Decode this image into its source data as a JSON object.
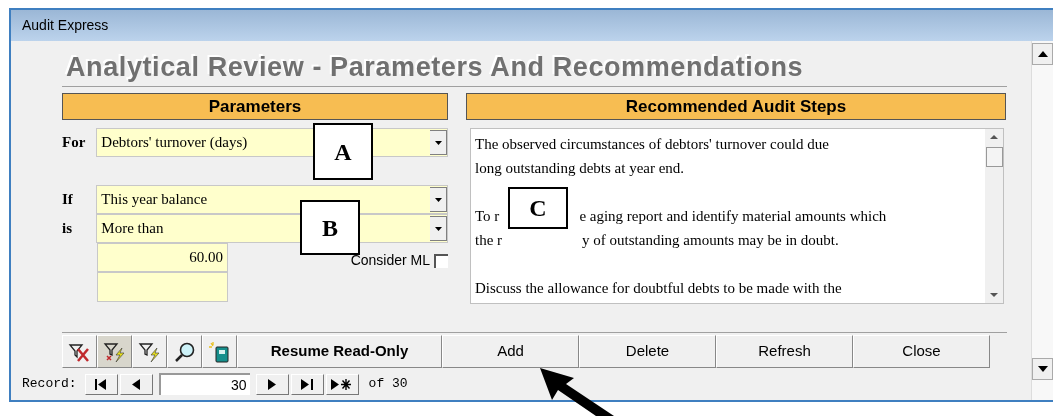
{
  "window": {
    "title": "Audit Express"
  },
  "heading": "Analytical Review - Parameters And Recommendations",
  "parameters": {
    "header": "Parameters",
    "fields": [
      {
        "label": "For",
        "value": "Debtors' turnover (days)"
      },
      {
        "label": "If",
        "value": "This year balance"
      },
      {
        "label": "is",
        "value": "More than"
      }
    ],
    "amount": "60.00",
    "consider_ml": {
      "label": "Consider ML",
      "checked": false
    }
  },
  "recommended": {
    "header": "Recommended Audit Steps",
    "paragraphs": [
      [
        "The observed circumstances of debtors' turnover could due",
        "long outstanding debts at year end."
      ],
      [
        [
          "To r",
          "e aging report and identify material amounts which"
        ],
        [
          "the r",
          "y of outstanding amounts may be in doubt."
        ]
      ],
      [
        "Discuss the allowance for doubtful debts to be made with the"
      ]
    ]
  },
  "buttons": [
    {
      "label": "Resume Read-Only",
      "kind": "bold"
    },
    {
      "label": "Add",
      "kind": "plain"
    },
    {
      "label": "Delete",
      "kind": "plain"
    },
    {
      "label": "Refresh",
      "kind": "plain"
    },
    {
      "label": "Close",
      "kind": "plain"
    }
  ],
  "record": {
    "label": "Record:",
    "current": "30",
    "total": "of 30"
  },
  "callouts": [
    {
      "label": "A"
    },
    {
      "label": "B"
    },
    {
      "label": "C"
    }
  ]
}
